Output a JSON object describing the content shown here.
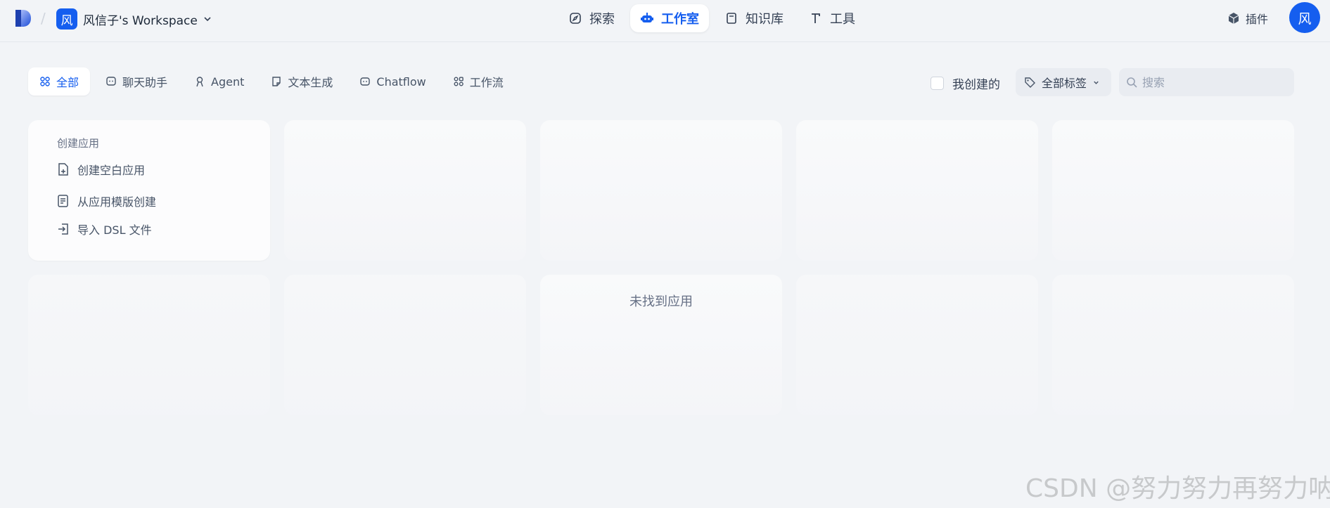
{
  "header": {
    "workspace": {
      "avatar": "风",
      "name": "风信子's Workspace"
    },
    "nav": [
      {
        "label": "探索",
        "icon": "compass-icon"
      },
      {
        "label": "工作室",
        "icon": "robot-icon",
        "active": true
      },
      {
        "label": "知识库",
        "icon": "book-icon"
      },
      {
        "label": "工具",
        "icon": "hammer-icon"
      }
    ],
    "plugin_label": "插件",
    "user_avatar": "风"
  },
  "filters": {
    "tabs": [
      {
        "label": "全部",
        "icon": "grid-icon",
        "active": true
      },
      {
        "label": "聊天助手",
        "icon": "chat-icon"
      },
      {
        "label": "Agent",
        "icon": "agent-icon"
      },
      {
        "label": "文本生成",
        "icon": "note-icon"
      },
      {
        "label": "Chatflow",
        "icon": "chatflow-icon"
      },
      {
        "label": "工作流",
        "icon": "workflow-icon"
      }
    ],
    "mine_label": "我创建的",
    "tags_label": "全部标签",
    "search_placeholder": "搜索"
  },
  "create_card": {
    "title": "创建应用",
    "items": [
      {
        "label": "创建空白应用",
        "icon": "file-plus-icon"
      },
      {
        "label": "从应用模版创建",
        "icon": "template-icon"
      },
      {
        "label": "导入 DSL 文件",
        "icon": "import-icon"
      }
    ]
  },
  "empty_state": "未找到应用",
  "watermark": "CSDN @努力努力再努力呐",
  "colors": {
    "accent": "#155eef",
    "background": "#f2f4f7"
  }
}
